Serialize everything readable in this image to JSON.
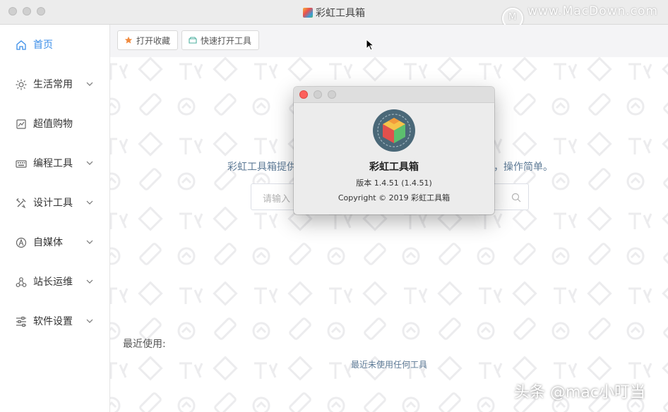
{
  "window": {
    "title": "彩虹工具箱",
    "watermark_site": "www.MacDown.com",
    "watermark_logo_letter": "M",
    "watermark_bottom": "头条 @mac小叮当"
  },
  "sidebar": {
    "items": [
      {
        "label": "首页",
        "icon": "home-icon",
        "active": true,
        "expandable": false
      },
      {
        "label": "生活常用",
        "icon": "sun-icon",
        "active": false,
        "expandable": true
      },
      {
        "label": "超值购物",
        "icon": "shopping-icon",
        "active": false,
        "expandable": false
      },
      {
        "label": "编程工具",
        "icon": "keyboard-icon",
        "active": false,
        "expandable": true
      },
      {
        "label": "设计工具",
        "icon": "design-tools-icon",
        "active": false,
        "expandable": true
      },
      {
        "label": "自媒体",
        "icon": "compass-icon",
        "active": false,
        "expandable": true
      },
      {
        "label": "站长运维",
        "icon": "network-icon",
        "active": false,
        "expandable": true
      },
      {
        "label": "软件设置",
        "icon": "sliders-icon",
        "active": false,
        "expandable": true
      }
    ]
  },
  "toolbar": {
    "favorites_label": "打开收藏",
    "quick_open_label": "快速打开工具"
  },
  "main": {
    "intro_left": "彩虹工具箱提供",
    "intro_right": "，操作简单。",
    "search_placeholder": "请输入",
    "recent_label": "最近使用:",
    "recent_empty": "最近未使用任何工具"
  },
  "about_dialog": {
    "app_name": "彩虹工具箱",
    "version": "版本 1.4.51 (1.4.51)",
    "copyright": "Copyright © 2019 彩虹工具箱"
  },
  "colors": {
    "accent": "#3b8ee8",
    "muted_text": "#5d7a96",
    "close_red": "#fc605c"
  }
}
